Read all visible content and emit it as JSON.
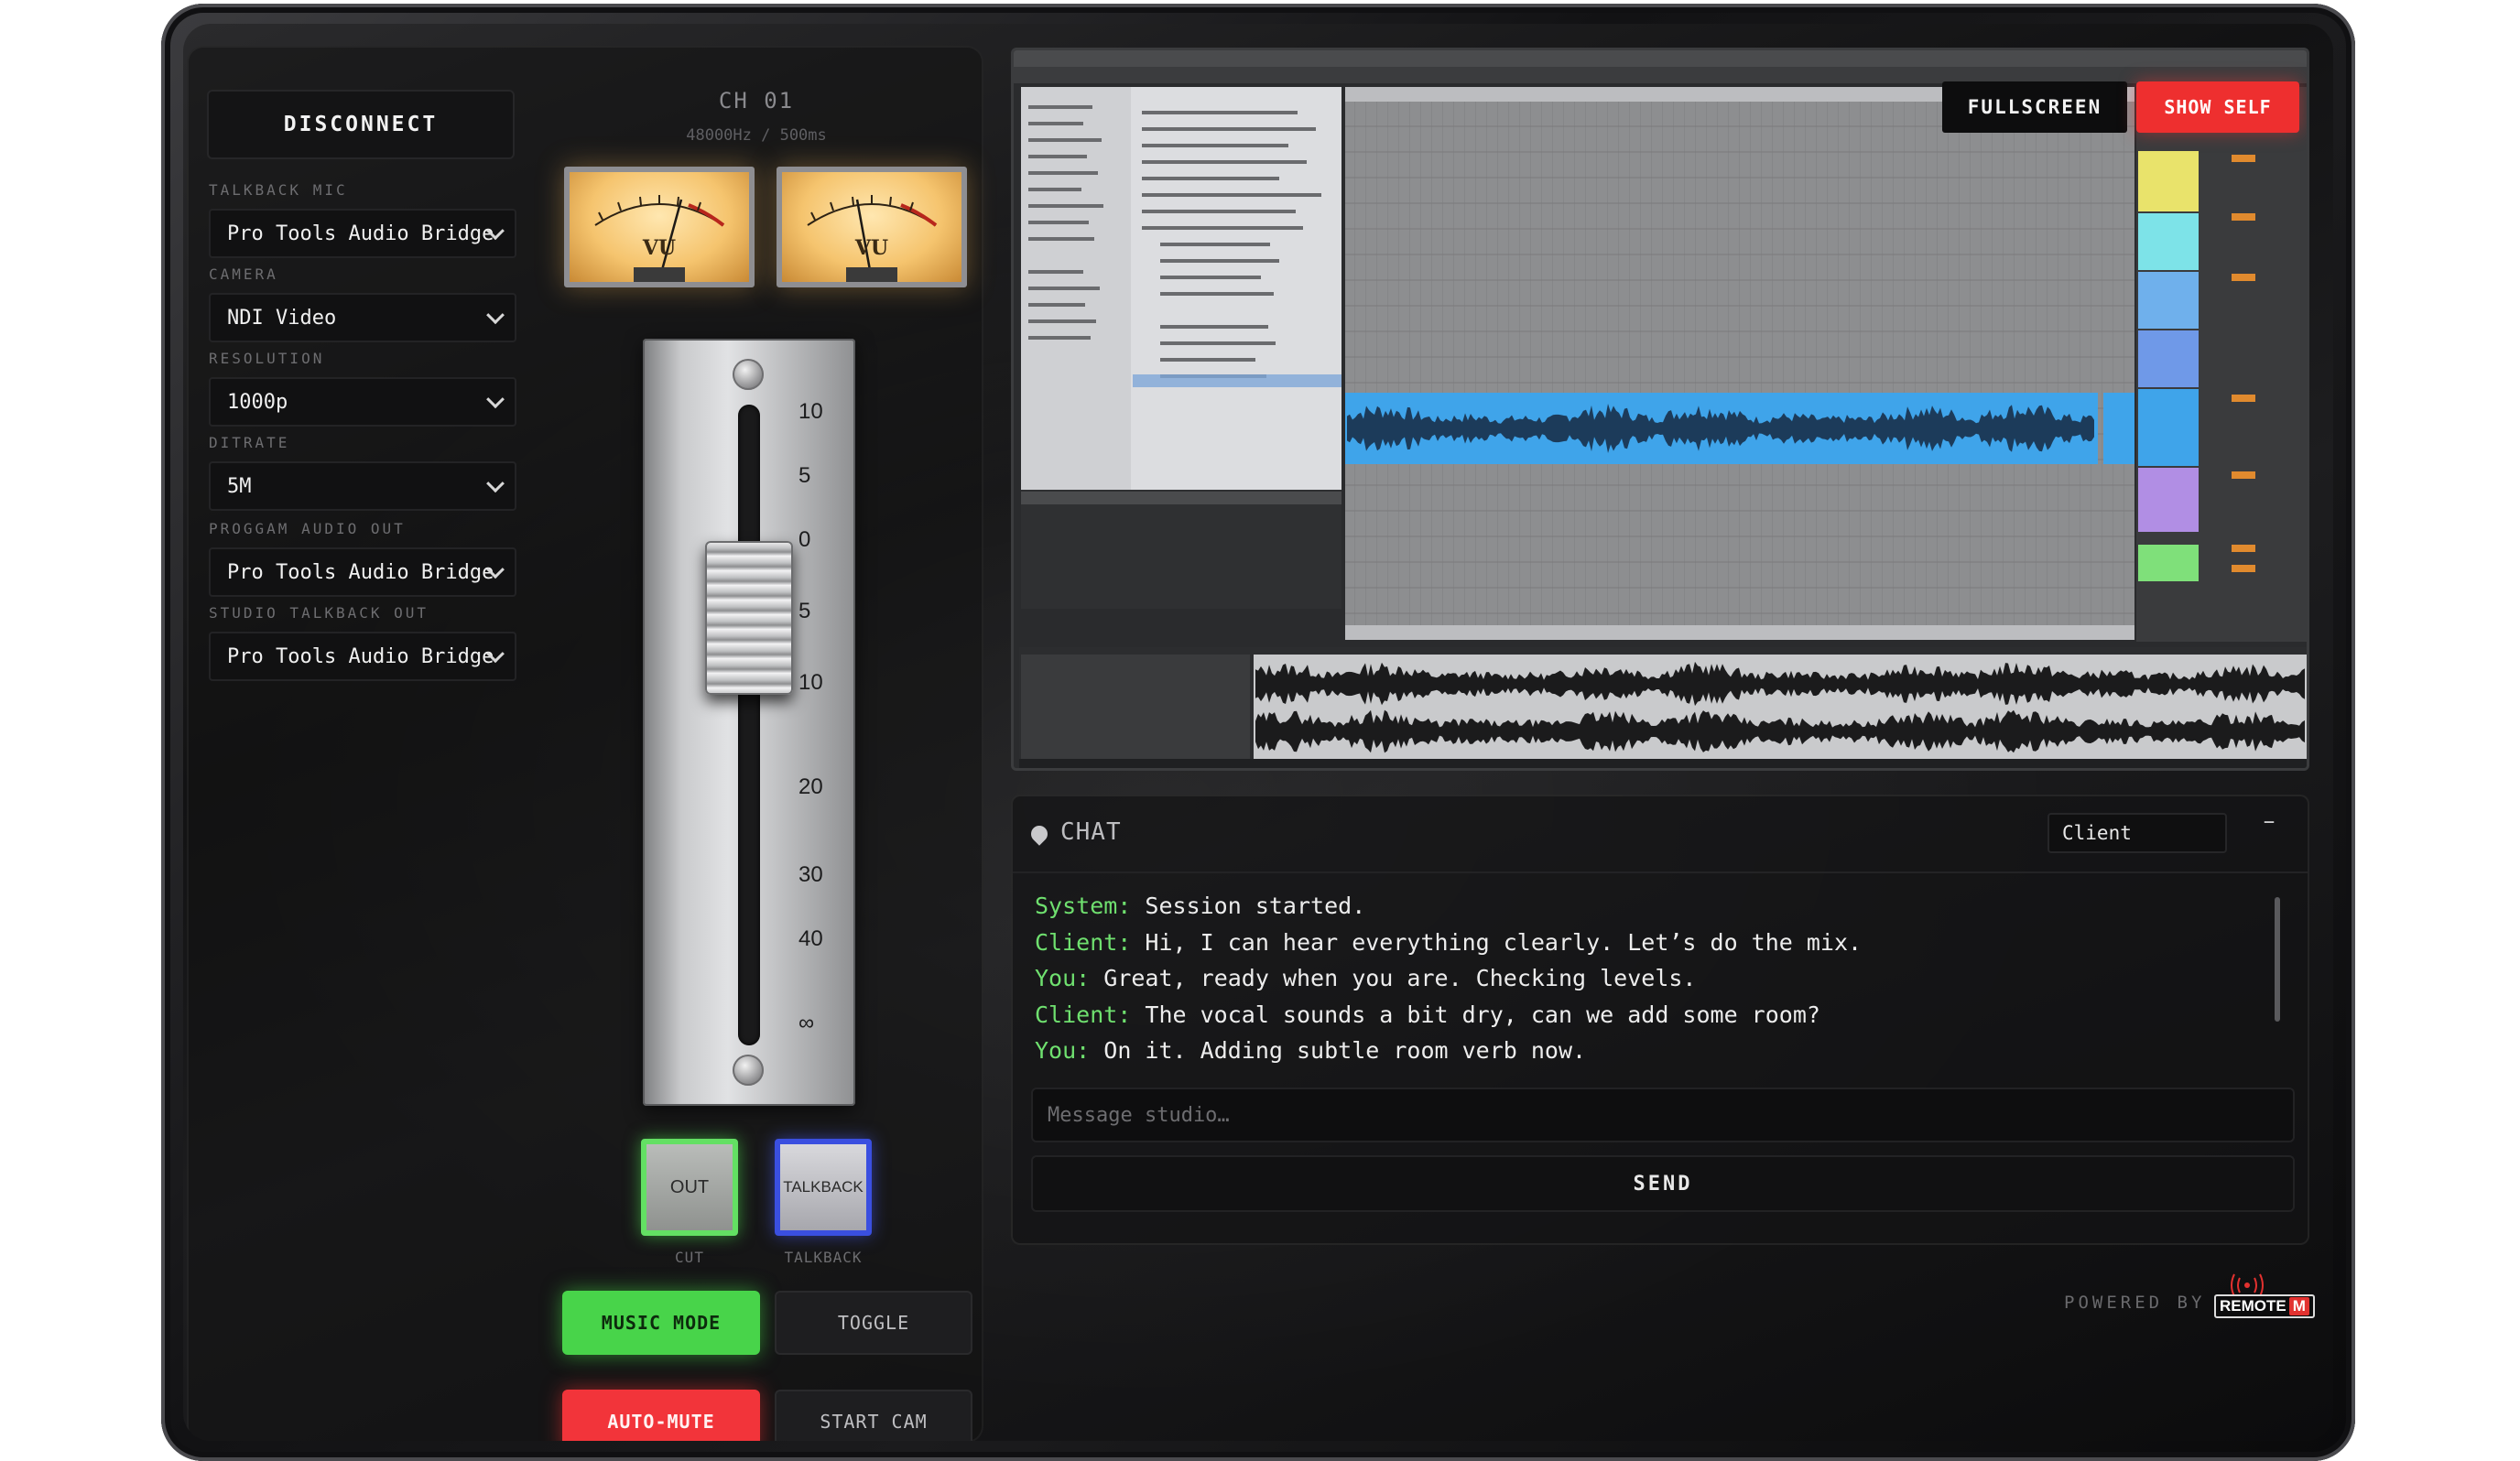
{
  "left_panel": {
    "disconnect_label": "DISCONNECT",
    "fields": [
      {
        "label": "TALKBACK MIC",
        "value": "Pro Tools Audio Bridge"
      },
      {
        "label": "CAMERA",
        "value": "NDI Video"
      },
      {
        "label": "RESOLUTION",
        "value": "1000p"
      },
      {
        "label": "DITRATE",
        "value": "5M"
      },
      {
        "label": "PROGGAM AUDIO OUT",
        "value": "Pro Tools Audio Bridge"
      },
      {
        "label": "STUDIO TALKBACK OUT",
        "value": "Pro Tools Audio Bridge"
      }
    ],
    "channel": {
      "title": "CH 01",
      "subtitle": "48000Hz / 500ms"
    },
    "vu_meters": [
      {
        "label": "VU"
      },
      {
        "label": "VU"
      }
    ],
    "fader": {
      "scale": [
        "10",
        "5",
        "0",
        "5",
        "10",
        "20",
        "30",
        "40",
        "∞"
      ],
      "level": 0.72
    },
    "out_button": {
      "label": "OUT",
      "caption": "CUT"
    },
    "talkback_button": {
      "label": "TALKBACK",
      "caption": "TALKBACK"
    },
    "music_mode_label": "MUSIC MODE",
    "toggle_label": "TOGGLE",
    "auto_mute_label": "AUTO-MUTE",
    "start_cam_label": "START CAM"
  },
  "screen_share": {
    "fullscreen_label": "FULLSCREEN",
    "show_self_label": "SHOW SELF"
  },
  "chat": {
    "title": "CHAT",
    "recipient": "Client",
    "minimize_glyph": "–",
    "messages": [
      {
        "sender": "System:",
        "text": "Session started."
      },
      {
        "sender": "Client:",
        "text": "Hi, I can hear everything clearly. Let’s do the mix."
      },
      {
        "sender": "You:",
        "text": "Great, ready when you are. Checking levels."
      },
      {
        "sender": "Client:",
        "text": "The vocal sounds a bit dry, can we add some room?"
      },
      {
        "sender": "You:",
        "text": "On it. Adding subtle room verb now."
      }
    ],
    "input_placeholder": "Message studio…",
    "send_label": "SEND"
  },
  "footer": {
    "powered_by": "POWERED BY",
    "logo_word": "REMOTE",
    "logo_mark": "M"
  },
  "colors": {
    "accent_green": "#48d44a",
    "accent_red": "#f2343a",
    "talkback_blue": "#3a4fe0",
    "chat_sender": "#6fe06f"
  },
  "icons": [
    "chevron-down-icon",
    "chat-bubble-icon",
    "minimize-icon",
    "broadcast-icon"
  ]
}
